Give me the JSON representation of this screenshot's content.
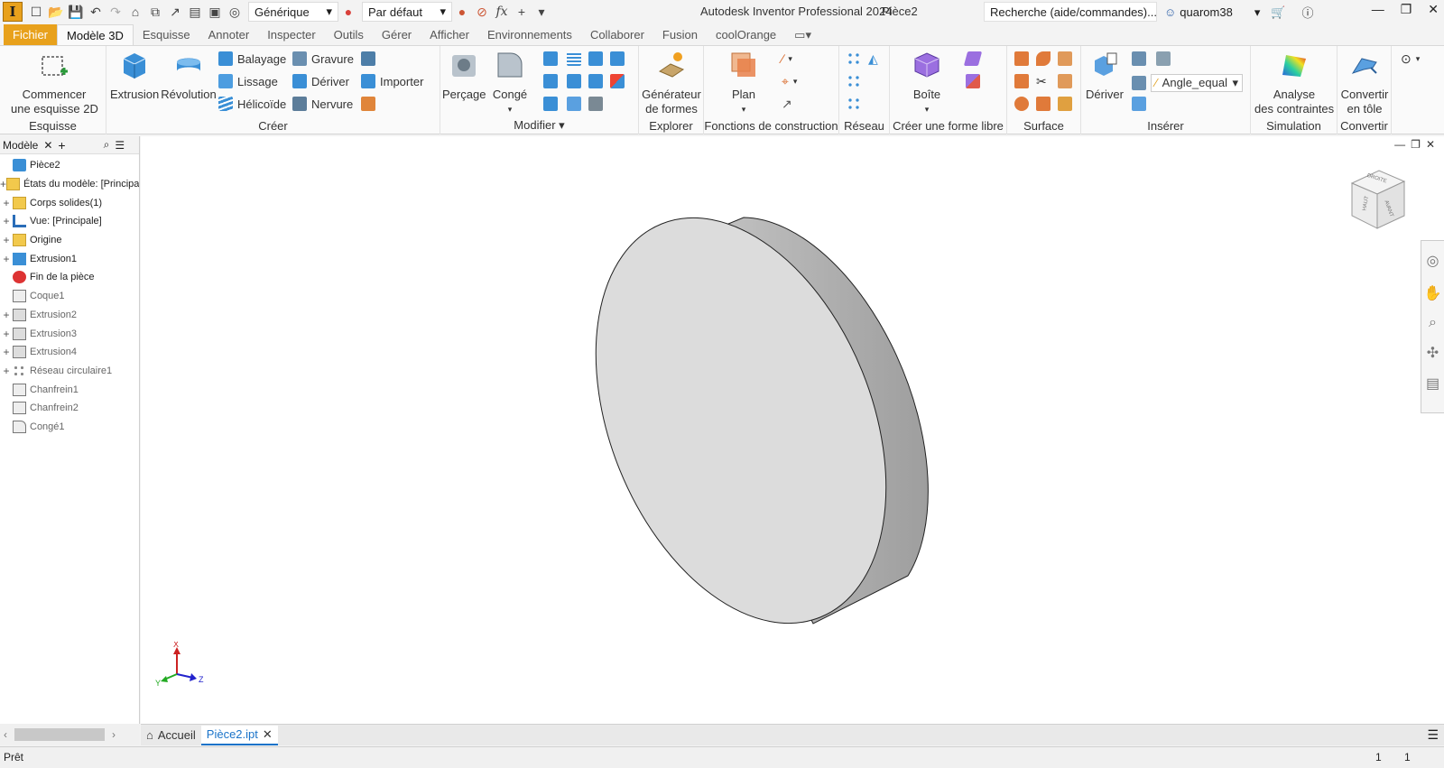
{
  "qat": {
    "logo": "I",
    "material": "Générique",
    "appearance": "Par défaut",
    "fx": "fx"
  },
  "title": {
    "app": "Autodesk Inventor Professional 2024",
    "doc": "Pièce2"
  },
  "search": {
    "placeholder": "Recherche (aide/commandes)..."
  },
  "user": {
    "name": "quarom38"
  },
  "tabs": [
    "Fichier",
    "Modèle 3D",
    "Esquisse",
    "Annoter",
    "Inspecter",
    "Outils",
    "Gérer",
    "Afficher",
    "Environnements",
    "Collaborer",
    "Fusion",
    "coolOrange"
  ],
  "ribbon": {
    "esquisse": {
      "btn1": "Commencer",
      "btn2": "une esquisse 2D",
      "label": "Esquisse"
    },
    "creer": {
      "extrusion": "Extrusion",
      "revolution": "Révolution",
      "balayage": "Balayage",
      "lissage": "Lissage",
      "helicoide": "Hélicoïde",
      "gravure": "Gravure",
      "deriver": "Dériver",
      "nervure": "Nervure",
      "importer": "Importer",
      "label": "Créer"
    },
    "modifier": {
      "percage": "Perçage",
      "conge": "Congé",
      "label": "Modifier"
    },
    "explorer": {
      "gen1": "Générateur",
      "gen2": "de formes",
      "label": "Explorer"
    },
    "construction": {
      "plan": "Plan",
      "label": "Fonctions de construction"
    },
    "reseau": {
      "label": "Réseau"
    },
    "formelibre": {
      "boite": "Boîte",
      "label": "Créer une forme libre"
    },
    "surface": {
      "label": "Surface"
    },
    "inserer": {
      "deriver": "Dériver",
      "param": "Angle_equal",
      "label": "Insérer"
    },
    "simulation": {
      "a1": "Analyse",
      "a2": "des contraintes",
      "label": "Simulation"
    },
    "convertir": {
      "c1": "Convertir",
      "c2": "en tôle",
      "label": "Convertir"
    }
  },
  "browser": {
    "tab": "Modèle",
    "nodes": [
      {
        "label": "Pièce2",
        "exp": "",
        "icon": "part-icon",
        "dim": false
      },
      {
        "label": "États du modèle: [Principal]",
        "exp": "+",
        "icon": "folder-icon",
        "dim": false
      },
      {
        "label": "Corps solides(1)",
        "exp": "+",
        "icon": "folder-icon",
        "dim": false
      },
      {
        "label": "Vue: [Principale]",
        "exp": "+",
        "icon": "view-icon",
        "dim": false
      },
      {
        "label": "Origine",
        "exp": "+",
        "icon": "folder-icon",
        "dim": false
      },
      {
        "label": "Extrusion1",
        "exp": "+",
        "icon": "extrusion-icon",
        "dim": false
      },
      {
        "label": "Fin de la pièce",
        "exp": "",
        "icon": "end-of-part-icon",
        "dim": false
      },
      {
        "label": "Coque1",
        "exp": "",
        "icon": "shell-icon",
        "dim": true
      },
      {
        "label": "Extrusion2",
        "exp": "+",
        "icon": "extrusion-suppressed-icon",
        "dim": true
      },
      {
        "label": "Extrusion3",
        "exp": "+",
        "icon": "extrusion-suppressed-icon",
        "dim": true
      },
      {
        "label": "Extrusion4",
        "exp": "+",
        "icon": "extrusion-suppressed-icon",
        "dim": true
      },
      {
        "label": "Réseau circulaire1",
        "exp": "+",
        "icon": "circular-pattern-icon",
        "dim": true
      },
      {
        "label": "Chanfrein1",
        "exp": "",
        "icon": "chamfer-icon",
        "dim": true
      },
      {
        "label": "Chanfrein2",
        "exp": "",
        "icon": "chamfer-icon",
        "dim": true
      },
      {
        "label": "Congé1",
        "exp": "",
        "icon": "fillet-icon",
        "dim": true
      }
    ]
  },
  "viewcube": {
    "face1": "DROITE",
    "face2": "HAUT",
    "face3": "AVANT"
  },
  "triad": {
    "x": "X",
    "y": "Y",
    "z": "Z"
  },
  "doctabs": {
    "home": "Accueil",
    "doc": "Pièce2.ipt"
  },
  "status": {
    "text": "Prêt",
    "n1": "1",
    "n2": "1"
  }
}
